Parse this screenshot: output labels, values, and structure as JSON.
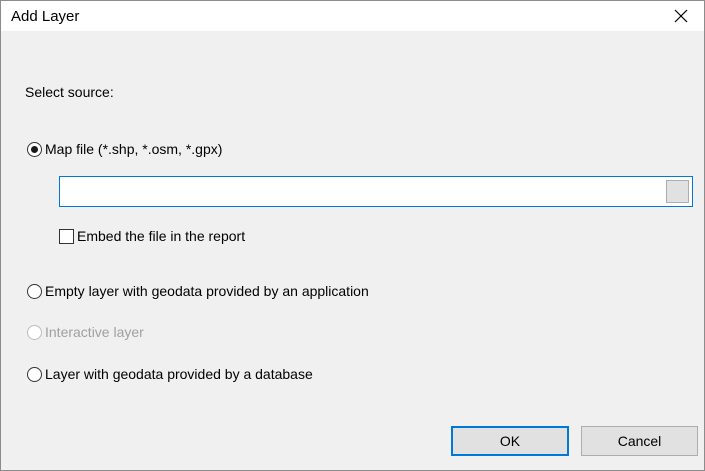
{
  "window": {
    "title": "Add Layer"
  },
  "main": {
    "select_source_label": "Select source:",
    "options": {
      "map_file": {
        "label": "Map file (*.shp, *.osm, *.gpx)",
        "checked": true,
        "enabled": true
      },
      "empty_layer": {
        "label": "Empty layer with geodata provided by an application",
        "checked": false,
        "enabled": true
      },
      "interactive_layer": {
        "label": "Interactive layer",
        "checked": false,
        "enabled": false
      },
      "database_layer": {
        "label": "Layer with geodata provided by a database",
        "checked": false,
        "enabled": true
      }
    },
    "file_path": {
      "value": "",
      "placeholder": ""
    },
    "embed_checkbox": {
      "label": "Embed the file in the report",
      "checked": false
    }
  },
  "footer": {
    "ok_label": "OK",
    "cancel_label": "Cancel"
  },
  "colors": {
    "accent": "#0078d7",
    "dialog_bg": "#f0f0f0",
    "title_bg": "#ffffff",
    "disabled_text": "#a0a0a0"
  }
}
